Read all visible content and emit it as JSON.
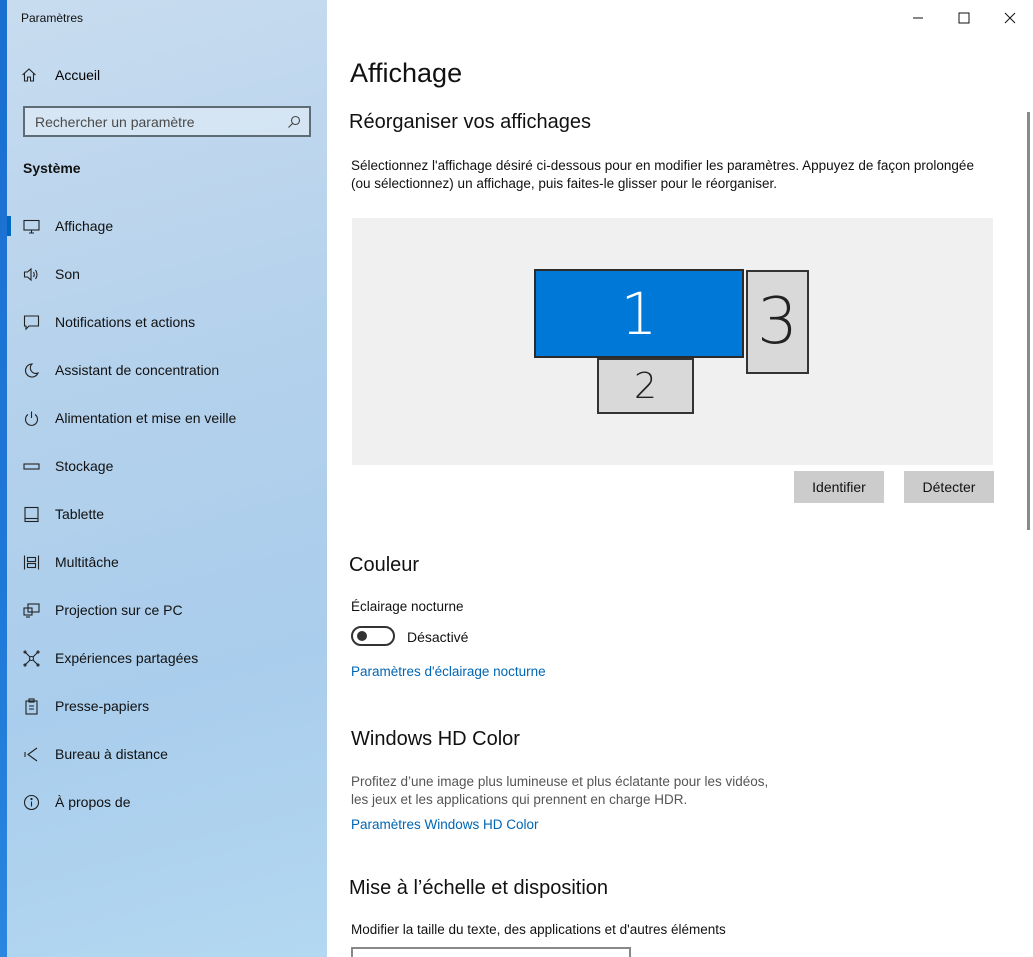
{
  "window": {
    "title": "Paramètres",
    "controls": [
      "minimize-icon",
      "maximize-icon",
      "close-icon"
    ]
  },
  "sidebar": {
    "home_label": "Accueil",
    "search_placeholder": "Rechercher un paramètre",
    "section_label": "Système",
    "items": [
      {
        "label": "Affichage",
        "icon": "monitor-icon",
        "active": true
      },
      {
        "label": "Son",
        "icon": "speaker-icon"
      },
      {
        "label": "Notifications et actions",
        "icon": "notification-icon"
      },
      {
        "label": "Assistant de concentration",
        "icon": "moon-icon"
      },
      {
        "label": "Alimentation et mise en veille",
        "icon": "power-icon"
      },
      {
        "label": "Stockage",
        "icon": "storage-icon"
      },
      {
        "label": "Tablette",
        "icon": "tablet-icon"
      },
      {
        "label": "Multitâche",
        "icon": "multitask-icon"
      },
      {
        "label": "Projection sur ce PC",
        "icon": "projection-icon"
      },
      {
        "label": "Expériences partagées",
        "icon": "shared-icon"
      },
      {
        "label": "Presse-papiers",
        "icon": "clipboard-icon"
      },
      {
        "label": "Bureau à distance",
        "icon": "remote-icon"
      },
      {
        "label": "À propos de",
        "icon": "info-icon"
      }
    ]
  },
  "main": {
    "page_title": "Affichage",
    "arrange": {
      "heading": "Réorganiser vos affichages",
      "line1": "Sélectionnez l'affichage désiré ci-dessous pour en modifier les paramètres. Appuyez de façon prolongée",
      "line2": "(ou sélectionnez) un affichage, puis faites-le glisser pour le réorganiser.",
      "monitors": [
        "1",
        "2",
        "3"
      ],
      "identify_label": "Identifier",
      "detect_label": "Détecter"
    },
    "color": {
      "heading": "Couleur",
      "night_light_label": "Éclairage nocturne",
      "toggle_state": "Désactivé",
      "night_light_link": "Paramètres d'éclairage nocturne"
    },
    "hdr": {
      "heading": "Windows HD Color",
      "line1": "Profitez d’une image plus lumineuse et plus éclatante pour les vidéos,",
      "line2": "les jeux et les applications qui prennent en charge HDR.",
      "link": "Paramètres Windows HD Color"
    },
    "scale": {
      "heading": "Mise à l’échelle et disposition",
      "description": "Modifier la taille du texte, des applications et d'autres éléments"
    }
  },
  "colors": {
    "accent": "#0078d7",
    "link": "#0066b4",
    "button": "#cccccc"
  }
}
